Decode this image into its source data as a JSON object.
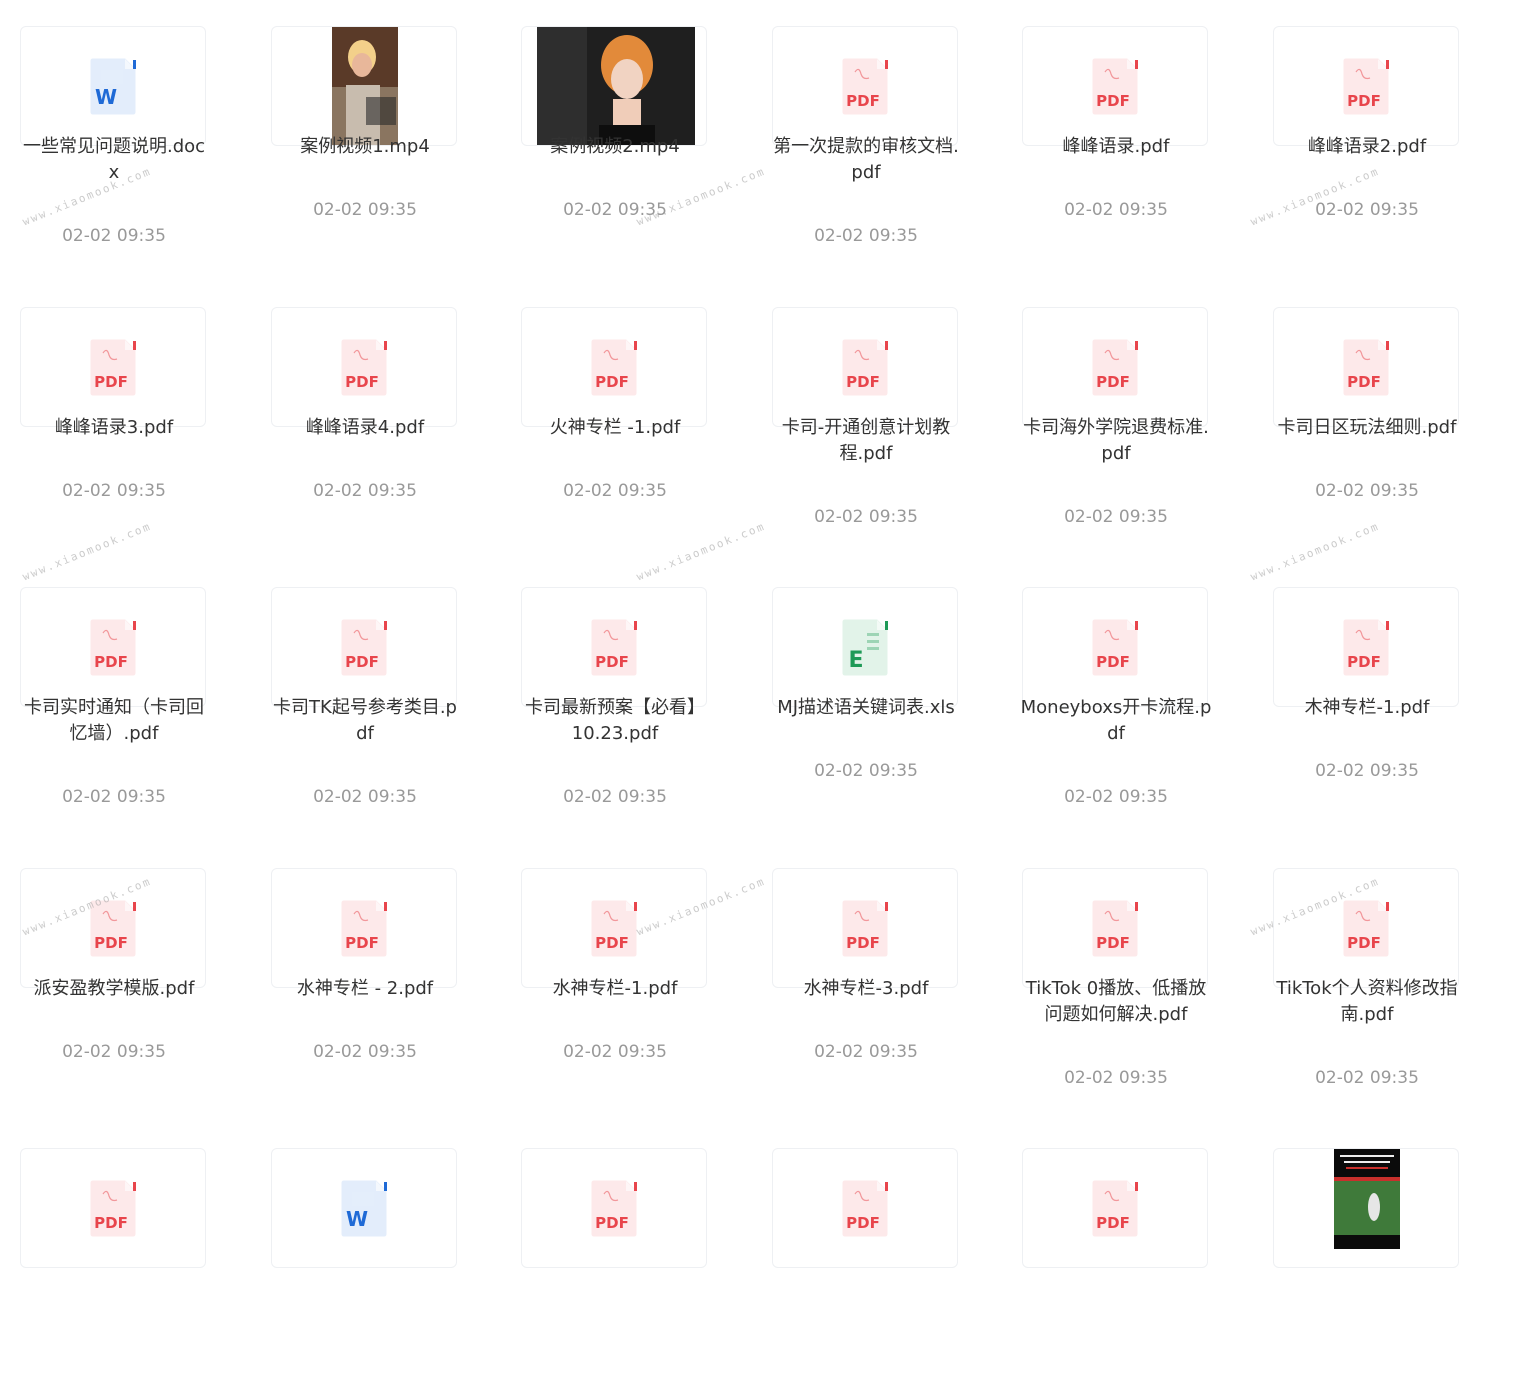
{
  "colors": {
    "pdf": "#e8454c",
    "pdf_bg": "#fde9ea",
    "word": "#1f6ad6",
    "word_bg": "#e3edfb",
    "excel": "#1e9a57",
    "excel_bg": "#e2f3e9"
  },
  "icon_labels": {
    "pdf": "PDF",
    "word": "W",
    "excel": "E"
  },
  "watermark": "www.xiaomook.com",
  "files": [
    {
      "name": "一些常见问题说明.doc\nx",
      "date": "02-02 09:35",
      "kind": "word"
    },
    {
      "name": "案例视频1.mp4",
      "date": "02-02 09:35",
      "kind": "video"
    },
    {
      "name": "案例视频2.mp4",
      "date": "02-02 09:35",
      "kind": "video"
    },
    {
      "name": "第一次提款的审核文档.\npdf",
      "date": "02-02 09:35",
      "kind": "pdf"
    },
    {
      "name": "峰峰语录.pdf",
      "date": "02-02 09:35",
      "kind": "pdf"
    },
    {
      "name": "峰峰语录2.pdf",
      "date": "02-02 09:35",
      "kind": "pdf"
    },
    {
      "name": "峰峰语录3.pdf",
      "date": "02-02 09:35",
      "kind": "pdf"
    },
    {
      "name": "峰峰语录4.pdf",
      "date": "02-02 09:35",
      "kind": "pdf"
    },
    {
      "name": "火神专栏 -1.pdf",
      "date": "02-02 09:35",
      "kind": "pdf"
    },
    {
      "name": "卡司-开通创意计划教\n程.pdf",
      "date": "02-02 09:35",
      "kind": "pdf"
    },
    {
      "name": "卡司海外学院退费标准.\npdf",
      "date": "02-02 09:35",
      "kind": "pdf"
    },
    {
      "name": "卡司日区玩法细则.pdf",
      "date": "02-02 09:35",
      "kind": "pdf"
    },
    {
      "name": "卡司实时通知（卡司回\n忆墙）.pdf",
      "date": "02-02 09:35",
      "kind": "pdf"
    },
    {
      "name": "卡司TK起号参考类目.p\ndf",
      "date": "02-02 09:35",
      "kind": "pdf"
    },
    {
      "name": "卡司最新预案【必看】\n10.23.pdf",
      "date": "02-02 09:35",
      "kind": "pdf"
    },
    {
      "name": "MJ描述语关键词表.xls",
      "date": "02-02 09:35",
      "kind": "excel"
    },
    {
      "name": "Moneyboxs开卡流程.p\ndf",
      "date": "02-02 09:35",
      "kind": "pdf"
    },
    {
      "name": "木神专栏-1.pdf",
      "date": "02-02 09:35",
      "kind": "pdf"
    },
    {
      "name": "派安盈教学模版.pdf",
      "date": "02-02 09:35",
      "kind": "pdf"
    },
    {
      "name": "水神专栏 - 2.pdf",
      "date": "02-02 09:35",
      "kind": "pdf"
    },
    {
      "name": "水神专栏-1.pdf",
      "date": "02-02 09:35",
      "kind": "pdf"
    },
    {
      "name": "水神专栏-3.pdf",
      "date": "02-02 09:35",
      "kind": "pdf"
    },
    {
      "name": "TikTok 0播放、低播放\n问题如何解决.pdf",
      "date": "02-02 09:35",
      "kind": "pdf"
    },
    {
      "name": "TikTok个人资料修改指\n南.pdf",
      "date": "02-02 09:35",
      "kind": "pdf"
    },
    {
      "name": "",
      "date": "",
      "kind": "pdf"
    },
    {
      "name": "",
      "date": "",
      "kind": "word"
    },
    {
      "name": "",
      "date": "",
      "kind": "pdf"
    },
    {
      "name": "",
      "date": "",
      "kind": "pdf"
    },
    {
      "name": "",
      "date": "",
      "kind": "pdf"
    },
    {
      "name": "",
      "date": "",
      "kind": "video"
    }
  ]
}
